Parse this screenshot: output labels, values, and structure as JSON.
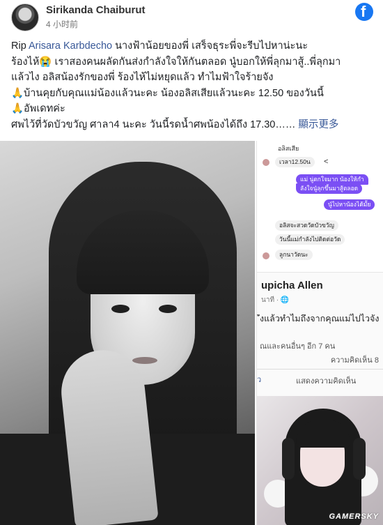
{
  "post": {
    "author": "Sirikanda Chaiburut",
    "time": "4 小时前",
    "lines": [
      {
        "pre": "Rip ",
        "mention": "Arisara Karbdecho",
        "post": " นางฟ้าน้อยของพี่ เสร็จธุระพี่จะรีบไปหาน่ะนะ"
      },
      {
        "text": "ร้องไห้😭 เราสองคนผลัดกันส่งกำลังใจให้กันตลอด นู๋บอกให้พี่ลุกมาสู้..พี่ลุกมา"
      },
      {
        "text": "แล้วไง อลิสน้องรักของพี่ ร้องไห้ไม่หยุดแล้ว ทำไมฟ้าใจร้ายจัง"
      },
      {
        "text": "🙏บ้านคุยกับคุณแม่น้องแล้วนะคะ น้องอลิสเสียแล้วนะคะ 12.50 ของวันนี้"
      },
      {
        "text": "🙏อัพเดทค่ะ"
      },
      {
        "pre": "ศพไว้ที่วัดบัวขวัญ ศาลา4 นะคะ วันนี้รดน้ำศพน้องได้ถึง 17.30…… ",
        "see_more": "顯示更多"
      }
    ]
  },
  "brand": {
    "logo_letter": "f",
    "color": "#1877f2"
  },
  "chat": {
    "top_name": "อลิสเสีย",
    "time_label": "เวลา12.50น",
    "share_icon": "share-icon",
    "bubbles_right": [
      "แม่ นู่ตกใจมาก น้องให้กำ",
      "ลังใจนู๋ลุกขึ้นมาสู้ตลอด",
      "นู๋ไปหาน้องได้มั้ย"
    ],
    "bubbles_left": [
      "อลิสจะสวดวัดบัวขวัญ",
      "วันนี้แม่กำลังไปติดต่อวัด",
      "ลูกนาวัดนะ"
    ]
  },
  "fb_card": {
    "name": "upicha Allen",
    "sub": "นาที · 🌐",
    "body": "ึงแล้วทำไมถึงจากคุณแม่ไปไวจัง",
    "reactions": "ณและคนอื่นๆ อีก 7 คน",
    "comments": "ความคิดเห็น 8",
    "left_edge": "ว",
    "comment_button": "แสดงความคิดเห็น"
  },
  "watermark": "GAMERSKY"
}
